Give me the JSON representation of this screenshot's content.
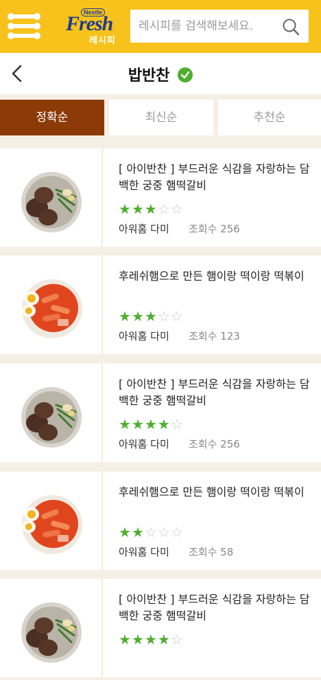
{
  "header": {
    "logo_badge": "Nestle",
    "logo_word": "Fresh",
    "logo_sub": "레시피",
    "search_placeholder": "레시피를 검색해보세요."
  },
  "titlebar": {
    "title": "밥반찬"
  },
  "tabs": [
    {
      "label": "정확순",
      "active": true
    },
    {
      "label": "최신순",
      "active": false
    },
    {
      "label": "추천순",
      "active": false
    }
  ],
  "recipes": [
    {
      "title": "[ 아이반찬 ] 부드러운 식감을 자랑하는 담백한 궁중 햄떡갈비",
      "rating": 3,
      "author": "아워홈 다미",
      "views": "조회수 256",
      "image": "galbi"
    },
    {
      "title": "후레쉬햄으로 만든 햄이랑 떡이랑 떡볶이",
      "rating": 3,
      "author": "아워홈 다미",
      "views": "조회수 123",
      "image": "tteokbokki"
    },
    {
      "title": "[ 아이반찬 ] 부드러운 식감을 자랑하는 담백한 궁중 햄떡갈비",
      "rating": 4,
      "author": "아워홈 다미",
      "views": "조회수 256",
      "image": "galbi"
    },
    {
      "title": "후레쉬햄으로 만든 햄이랑 떡이랑 떡볶이",
      "rating": 2,
      "author": "아워홈 다미",
      "views": "조회수 58",
      "image": "tteokbokki"
    },
    {
      "title": "[ 아이반찬 ] 부드러운 식감을 자랑하는 담백한 궁중 햄떡갈비",
      "rating": 4,
      "author": "",
      "views": "",
      "image": "galbi"
    }
  ],
  "colors": {
    "brand_yellow": "#f7c21b",
    "active_tab": "#8b3a08",
    "star_green": "#4fae2e"
  }
}
